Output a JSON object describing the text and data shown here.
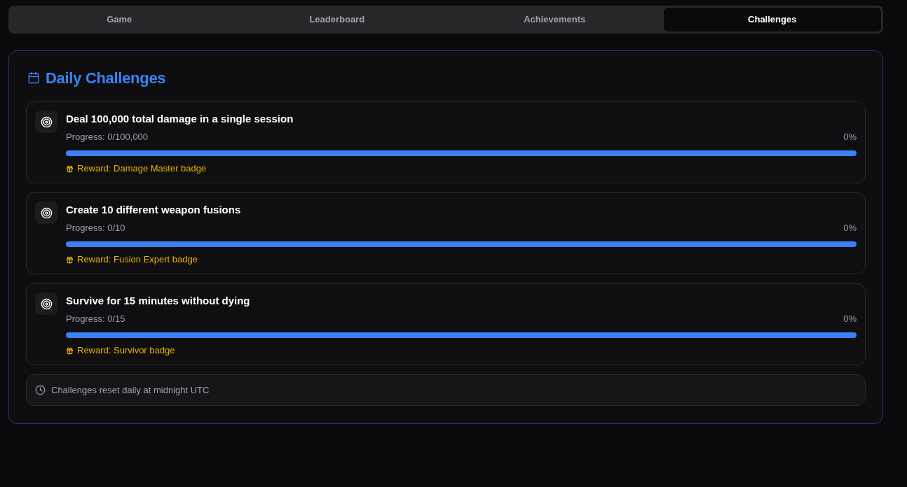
{
  "tabs": [
    {
      "label": "Game",
      "selected": false
    },
    {
      "label": "Leaderboard",
      "selected": false
    },
    {
      "label": "Achievements",
      "selected": false
    },
    {
      "label": "Challenges",
      "selected": true
    }
  ],
  "panel": {
    "title": "Daily Challenges",
    "challenges": [
      {
        "title": "Deal 100,000 total damage in a single session",
        "progress": "Progress: 0/100,000",
        "percent": "0%",
        "level": 0,
        "reward": "Reward: Damage Master badge"
      },
      {
        "title": "Create 10 different weapon fusions",
        "progress": "Progress: 0/10",
        "percent": "0%",
        "level": 0,
        "reward": "Reward: Fusion Expert badge"
      },
      {
        "title": "Survive for 15 minutes without dying",
        "progress": "Progress: 0/15",
        "percent": "0%",
        "level": 0,
        "reward": "Reward: Survivor badge"
      }
    ],
    "footer": "Challenges reset daily at midnight UTC"
  }
}
